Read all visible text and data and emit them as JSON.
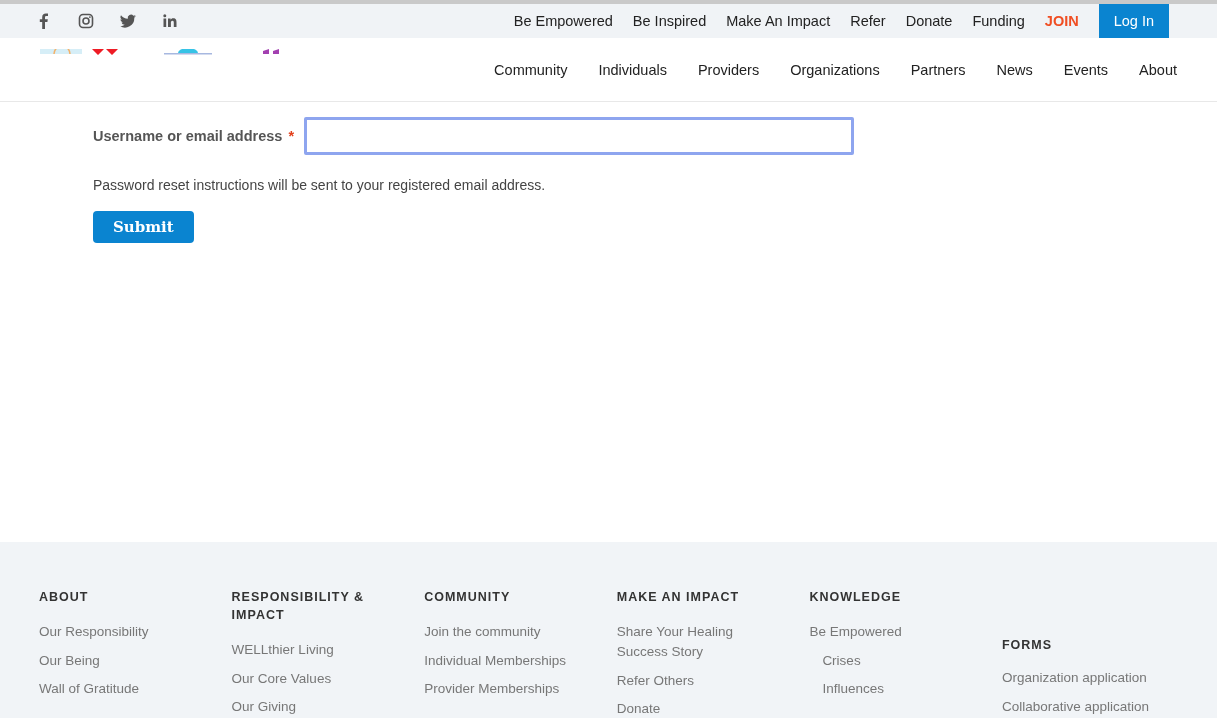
{
  "top_bar": {
    "links": [
      {
        "label": "Be Empowered",
        "kind": "link"
      },
      {
        "label": "Be Inspired",
        "kind": "link"
      },
      {
        "label": "Make An Impact",
        "kind": "link"
      },
      {
        "label": "Refer",
        "kind": "link"
      },
      {
        "label": "Donate",
        "kind": "link"
      },
      {
        "label": "Funding",
        "kind": "link"
      },
      {
        "label": "JOIN",
        "kind": "highlight"
      },
      {
        "label": "Log In",
        "kind": "button"
      }
    ]
  },
  "main_nav": [
    "Community",
    "Individuals",
    "Providers",
    "Organizations",
    "Partners",
    "News",
    "Events",
    "About"
  ],
  "form": {
    "label": "Username or email address",
    "required_mark": "*",
    "focused": true,
    "help": "Password reset instructions will be sent to your registered email address.",
    "submit": "Submit"
  },
  "footer": {
    "columns": [
      {
        "title": "ABOUT",
        "items": [
          {
            "label": "Our Responsibility"
          },
          {
            "label": "Our Being"
          },
          {
            "label": "Wall of Gratitude"
          }
        ]
      },
      {
        "title": "RESPONSIBILITY & IMPACT",
        "items": [
          {
            "label": "WELLthier Living"
          },
          {
            "label": "Our Core Values"
          },
          {
            "label": "Our Giving"
          }
        ]
      },
      {
        "title": "COMMUNITY",
        "items": [
          {
            "label": "Join the community"
          },
          {
            "label": "Individual Memberships"
          },
          {
            "label": "Provider Memberships"
          }
        ]
      },
      {
        "title": "MAKE AN IMPACT",
        "items": [
          {
            "label": "Share Your Healing Success Story"
          },
          {
            "label": "Refer Others"
          },
          {
            "label": "Donate"
          }
        ]
      },
      {
        "title": "KNOWLEDGE",
        "items": [
          {
            "label": "Be Empowered",
            "children": [
              {
                "label": "Crises"
              },
              {
                "label": "Influences"
              }
            ]
          }
        ]
      },
      {
        "title": "FORMS",
        "items": [
          {
            "label": "Organization application"
          },
          {
            "label": "Collaborative application"
          }
        ]
      }
    ]
  }
}
